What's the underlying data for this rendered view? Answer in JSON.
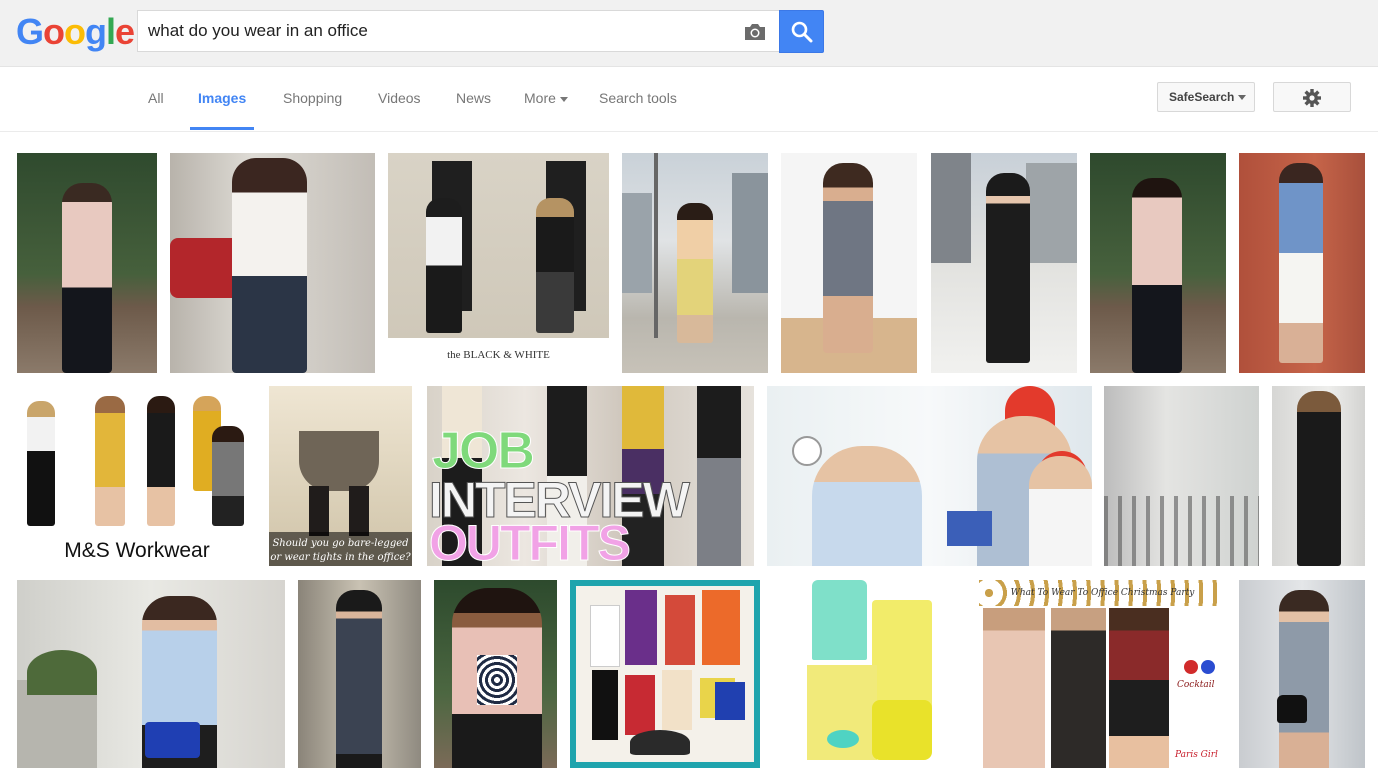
{
  "logo": {
    "text": "Google",
    "letters": [
      "G",
      "o",
      "o",
      "g",
      "l",
      "e"
    ],
    "colors": [
      "#4285f4",
      "#ea4335",
      "#fbbc05",
      "#4285f4",
      "#34a853",
      "#ea4335"
    ]
  },
  "search": {
    "value": "what do you wear in an office",
    "camera_icon": "camera-icon",
    "button_icon": "search-icon"
  },
  "nav": {
    "tabs": [
      {
        "label": "All"
      },
      {
        "label": "Images"
      },
      {
        "label": "Shopping"
      },
      {
        "label": "Videos"
      },
      {
        "label": "News"
      },
      {
        "label": "More"
      },
      {
        "label": "Search tools"
      }
    ],
    "active_tab": "Images",
    "safesearch_label": "SafeSearch",
    "settings_icon": "gear-icon"
  },
  "colors": {
    "accent": "#4285f4",
    "topbar": "#f1f1f1",
    "tab_text": "#777777"
  },
  "results": {
    "captions": {
      "black_white": "the BLACK & WHITE",
      "ms_workwear": "M&S Workwear",
      "bare_legged_1": "Should you go bare-legged",
      "bare_legged_2": "or wear tights in the office?",
      "job": "JOB",
      "interview": "INTERVIEW",
      "outfits": "OUTFITS",
      "christmas_party": "What To Wear To Office Christmas Party",
      "cocktail": "Cocktail",
      "paris": "Paris Girl"
    }
  }
}
